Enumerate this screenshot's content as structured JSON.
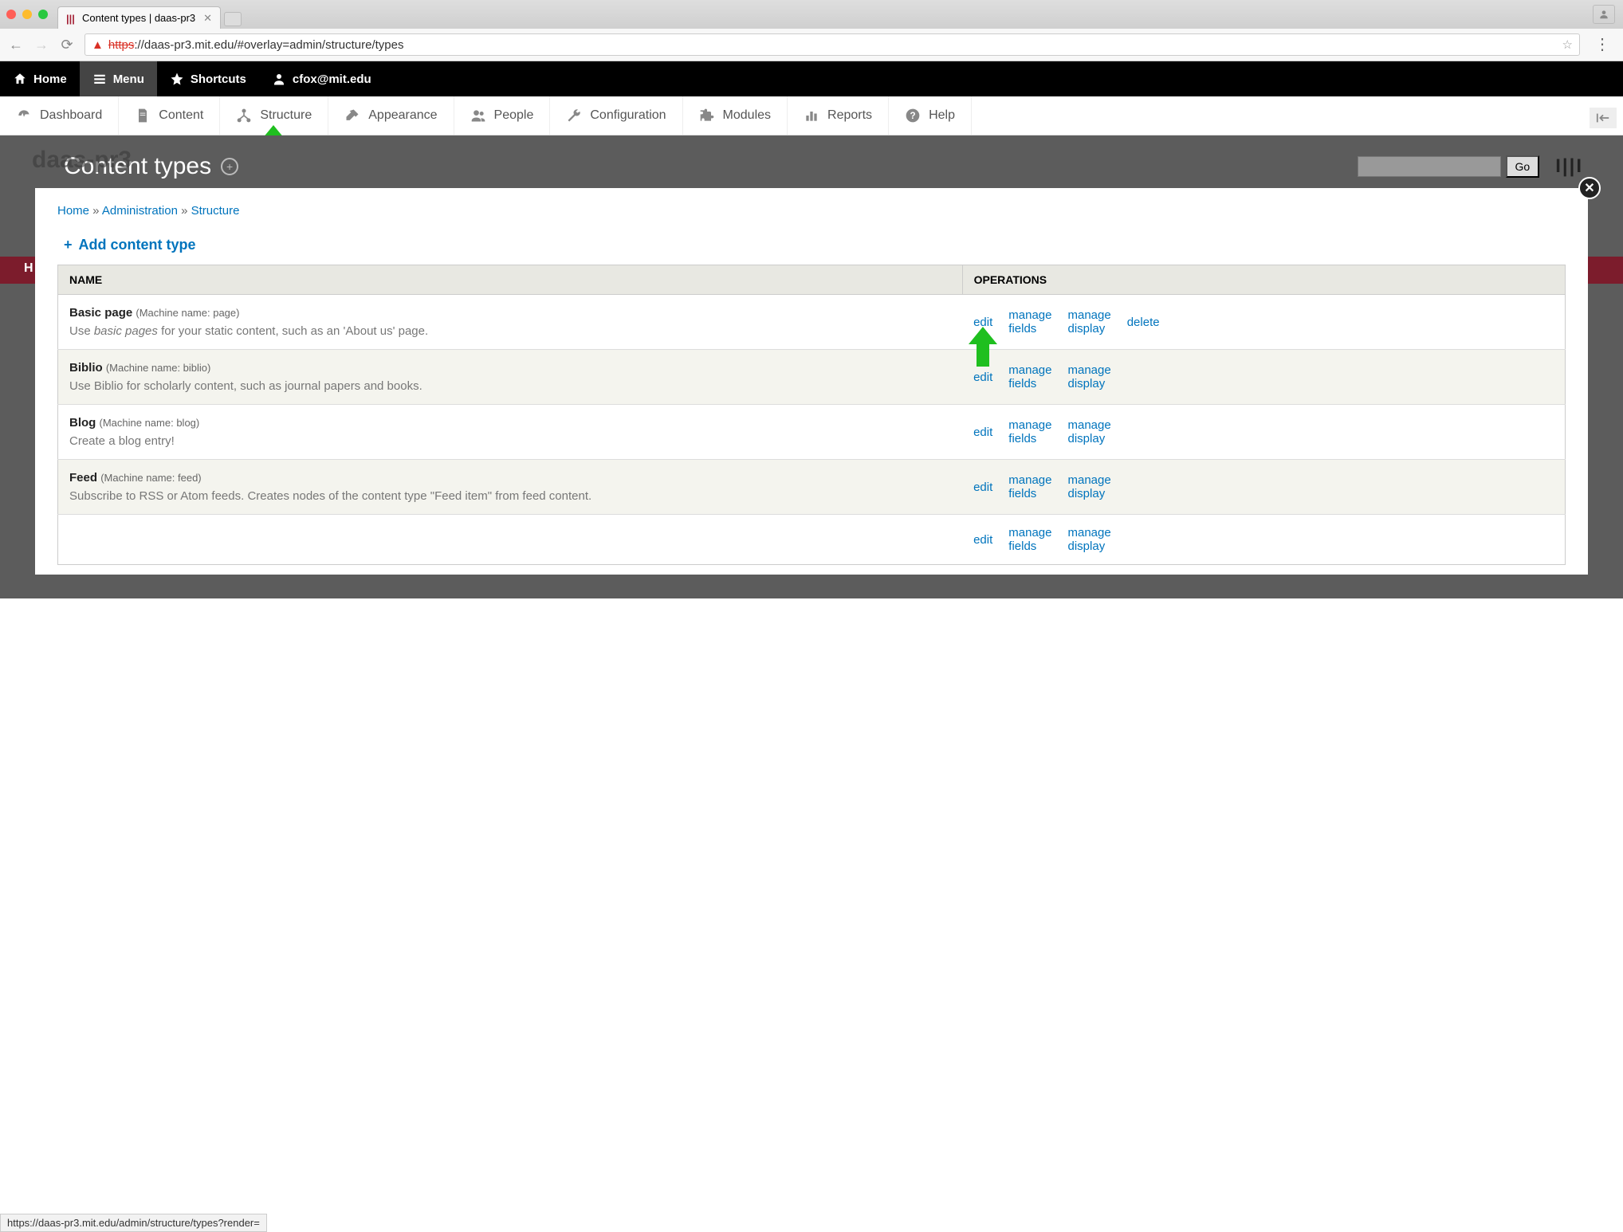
{
  "browser": {
    "tab_title": "Content types | daas-pr3",
    "url_proto": "https",
    "url_rest": "://daas-pr3.mit.edu/#overlay=admin/structure/types"
  },
  "admin_bar": {
    "home": "Home",
    "menu": "Menu",
    "shortcuts": "Shortcuts",
    "user": "cfox@mit.edu"
  },
  "menu_bar": [
    {
      "label": "Dashboard"
    },
    {
      "label": "Content"
    },
    {
      "label": "Structure"
    },
    {
      "label": "Appearance"
    },
    {
      "label": "People"
    },
    {
      "label": "Configuration"
    },
    {
      "label": "Modules"
    },
    {
      "label": "Reports"
    },
    {
      "label": "Help"
    }
  ],
  "bg_title": "daas-pr3",
  "page_title": "Content types",
  "search_go": "Go",
  "breadcrumb": {
    "home": "Home",
    "admin": "Administration",
    "structure": "Structure"
  },
  "add_link": "Add content type",
  "table": {
    "col_name": "NAME",
    "col_ops": "OPERATIONS",
    "rows": [
      {
        "name": "Basic page",
        "machine": "(Machine name: page)",
        "desc_pre": "Use ",
        "desc_em": "basic pages",
        "desc_post": " for your static content, such as an 'About us' page.",
        "ops": [
          "edit",
          "manage fields",
          "manage display",
          "delete"
        ]
      },
      {
        "name": "Biblio",
        "machine": "(Machine name: biblio)",
        "desc_pre": "Use Biblio for scholarly content, such as journal papers and books.",
        "desc_em": "",
        "desc_post": "",
        "ops": [
          "edit",
          "manage fields",
          "manage display"
        ]
      },
      {
        "name": "Blog",
        "machine": "(Machine name: blog)",
        "desc_pre": "Create a blog entry!",
        "desc_em": "",
        "desc_post": "",
        "ops": [
          "edit",
          "manage fields",
          "manage display"
        ]
      },
      {
        "name": "Feed",
        "machine": "(Machine name: feed)",
        "desc_pre": "Subscribe to RSS or Atom feeds. Creates nodes of the content type \"Feed item\" from feed content.",
        "desc_em": "",
        "desc_post": "",
        "ops": [
          "edit",
          "manage fields",
          "manage display"
        ]
      },
      {
        "name": "",
        "machine": "",
        "desc_pre": "",
        "desc_em": "",
        "desc_post": "",
        "ops": [
          "edit",
          "manage fields",
          "manage display"
        ]
      }
    ]
  },
  "status_url": "https://daas-pr3.mit.edu/admin/structure/types?render="
}
